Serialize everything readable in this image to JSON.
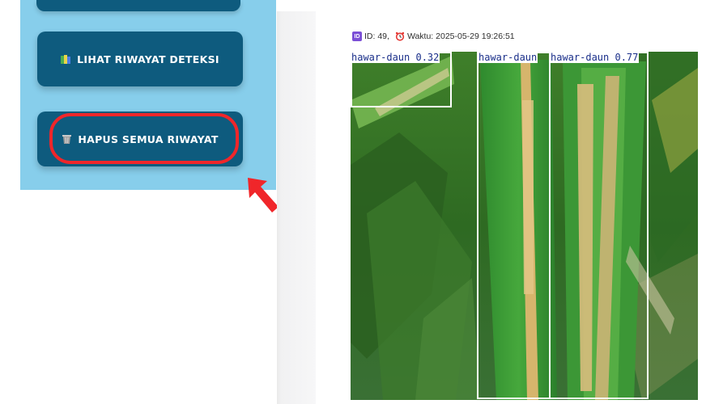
{
  "sidebar": {
    "history_button_label": "LIHAT RIWAYAT DETEKSI",
    "delete_button_label": "HAPUS SEMUA RIWAYAT",
    "history_icon": "books-icon",
    "delete_icon": "wastebasket-icon"
  },
  "record": {
    "id_text": "ID: 49,",
    "time_text": "Waktu: 2025-05-29 19:26:51"
  },
  "detections": [
    {
      "label": "hawar-daun 0.32"
    },
    {
      "label": "hawar-daun"
    },
    {
      "label": "hawar-daun 0.77"
    }
  ],
  "colors": {
    "sidebar_bg": "#87ceeb",
    "button_bg": "#0e5b7e",
    "highlight": "#f0262a",
    "box_stroke": "#ffffff",
    "label_text": "#1a2f8a"
  }
}
